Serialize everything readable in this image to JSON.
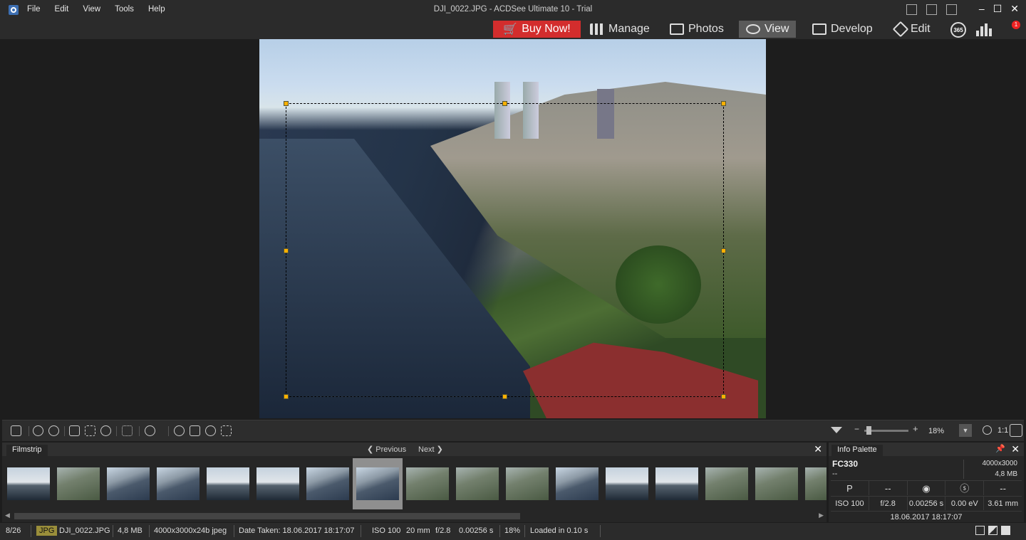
{
  "app": {
    "window_title": "DJI_0022.JPG - ACDSee Ultimate 10 - Trial",
    "menu": [
      "File",
      "Edit",
      "View",
      "Tools",
      "Help"
    ],
    "window_controls": [
      "–",
      "☐",
      "✕"
    ]
  },
  "modes": {
    "buy_now": "Buy Now!",
    "tabs": [
      {
        "label": "Manage",
        "icon": "grid-icon"
      },
      {
        "label": "Photos",
        "icon": "photos-icon"
      },
      {
        "label": "View",
        "icon": "eye-icon",
        "active": true
      },
      {
        "label": "Develop",
        "icon": "develop-icon"
      },
      {
        "label": "Edit",
        "icon": "edit-icon"
      }
    ],
    "badge_365": "365",
    "notification_count": "1"
  },
  "toolbar": {
    "zoom_value": "18%",
    "ratio_label": "1:1"
  },
  "filmstrip": {
    "title": "Filmstrip",
    "previous": "Previous",
    "next": "Next",
    "selected_index": 7
  },
  "info_palette": {
    "title": "Info Palette",
    "camera": "FC330",
    "camera_sub": "--",
    "dimensions": "4000x3000",
    "file_size": "4,8 MB",
    "icons": [
      "P",
      "--",
      "◉",
      "ⓢ",
      "--"
    ],
    "iso": "ISO 100",
    "aperture": "f/2.8",
    "shutter": "0.00256 s",
    "exposure": "0.00 eV",
    "focal": "3.61 mm",
    "date": "18.06.2017 18:17:07"
  },
  "status": {
    "position": "8/26",
    "type": "JPG",
    "filename": "DJI_0022.JPG",
    "size": "4,8 MB",
    "format": "4000x3000x24b jpeg",
    "date_taken": "Date Taken: 18.06.2017 18:17:07",
    "iso": "ISO 100",
    "focal": "20 mm",
    "aperture": "f/2.8",
    "shutter": "0.00256 s",
    "zoom": "18%",
    "loaded": "Loaded in 0.10 s"
  },
  "colors": {
    "accent_buy": "#d32d2d",
    "active_tab": "#5a5a5a",
    "crop_handle": "#ffb000"
  }
}
